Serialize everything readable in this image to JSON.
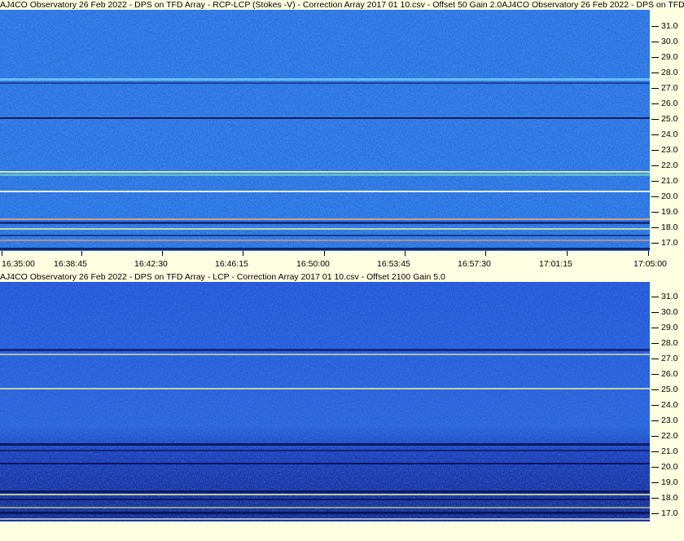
{
  "panel_top": {
    "title": "AJ4CO Observatory 26 Feb 2022  -  DPS on TFD Array  -  RCP-LCP (Stokes -V)  -  Correction Array 2017 01 10.csv  -  Offset 50  Gain 2.0AJ4CO Observatory 26 Feb 2022  -  DPS on TFD Array  -  RCP-LCP (Stokes -V)"
  },
  "panel_bottom": {
    "title": "AJ4CO Observatory 26 Feb 2022  -  DPS on TFD Array  -  LCP  -  Correction Array 2017 01 10.csv  -  Offset 2100  Gain 5.0"
  },
  "freq_labels": [
    "31.0",
    "30.0",
    "29.0",
    "28.0",
    "27.0",
    "26.0",
    "25.0",
    "24.0",
    "23.0",
    "22.0",
    "21.0",
    "20.0",
    "19.0",
    "18.0",
    "17.0"
  ],
  "time_labels": [
    "16:35:00",
    "16:38:45",
    "16:42:30",
    "16:46:15",
    "16:50:00",
    "16:53:45",
    "16:57:30",
    "17:01:15",
    "17:05:00"
  ],
  "colors": {
    "background": "#ffffe1",
    "spectrogram_top_base": "#2a6ee0",
    "spectrogram_bottom_base": "#1f44c8",
    "bright_band": "#ffffa0",
    "dark_band": "#0a1050"
  }
}
